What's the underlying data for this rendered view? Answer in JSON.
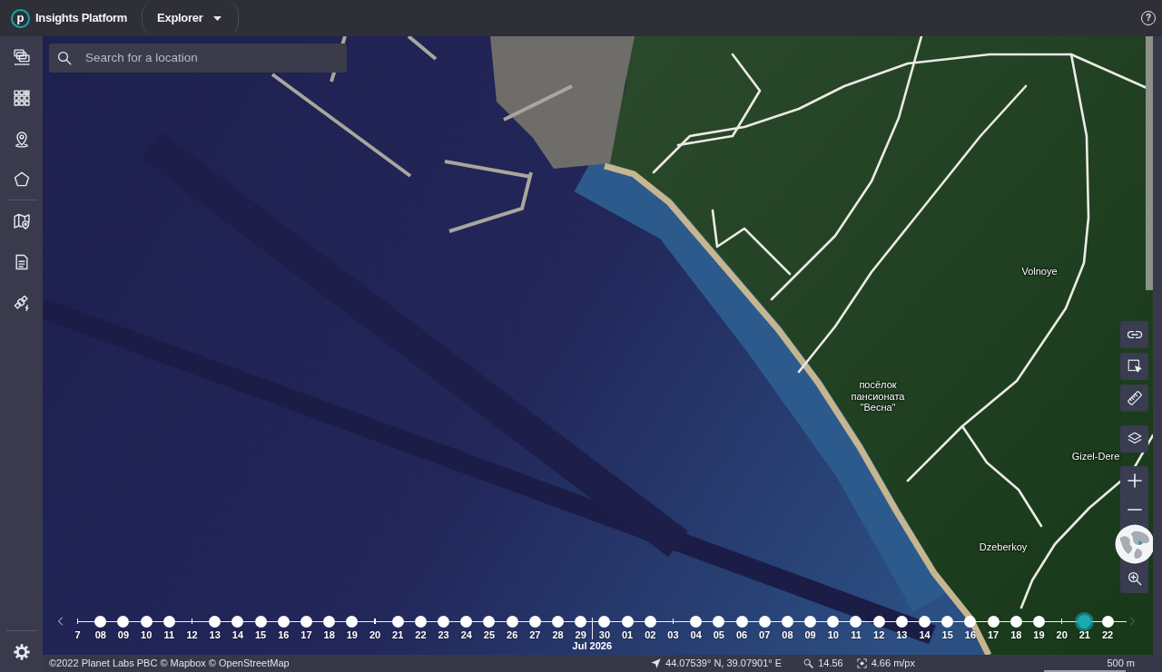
{
  "header": {
    "logo": {
      "letter": "p"
    },
    "title": "Insights Platform",
    "section_menu": {
      "label": "Explorer"
    },
    "help_button": {
      "label": "?"
    }
  },
  "sidebar": {
    "groups": [
      {
        "items": [
          {
            "kind": "screens"
          },
          {
            "kind": "grid"
          },
          {
            "kind": "pin"
          },
          {
            "kind": "polygon"
          }
        ]
      },
      {
        "items": [
          {
            "kind": "map"
          },
          {
            "kind": "report"
          },
          {
            "kind": "satellite"
          }
        ]
      }
    ],
    "footer_items": [
      {
        "kind": "settings"
      }
    ]
  },
  "search": {
    "placeholder": "Search for a location"
  },
  "map": {
    "labels": [
      {
        "text": "Volnoye"
      },
      {
        "text": "посёлок пансионата \"Весна\""
      },
      {
        "text": "Gizel-Dere"
      },
      {
        "text": "Dzeberkoy"
      }
    ]
  },
  "map_tools": {
    "groups": [
      {
        "kind": "buttons",
        "items": [
          {
            "kind": "link"
          },
          {
            "kind": "select"
          },
          {
            "kind": "measure"
          }
        ]
      },
      {
        "kind": "buttons",
        "items": [
          {
            "kind": "layers"
          }
        ]
      },
      {
        "kind": "panel",
        "items": [
          {
            "kind": "zoom-in"
          },
          {
            "kind": "zoom-out"
          },
          {
            "kind": "minimap"
          },
          {
            "kind": "zoom-to"
          }
        ]
      }
    ]
  },
  "timeline": {
    "prev_button": {
      "disabled": false
    },
    "next_button": {
      "disabled": true
    },
    "items": [
      {
        "label": "7",
        "imagery": false,
        "selected": false
      },
      {
        "label": "08",
        "imagery": true,
        "selected": false
      },
      {
        "label": "09",
        "imagery": true,
        "selected": false
      },
      {
        "label": "10",
        "imagery": true,
        "selected": false
      },
      {
        "label": "11",
        "imagery": true,
        "selected": false
      },
      {
        "label": "12",
        "imagery": false,
        "selected": false
      },
      {
        "label": "13",
        "imagery": true,
        "selected": false
      },
      {
        "label": "14",
        "imagery": true,
        "selected": false
      },
      {
        "label": "15",
        "imagery": true,
        "selected": false
      },
      {
        "label": "16",
        "imagery": true,
        "selected": false
      },
      {
        "label": "17",
        "imagery": true,
        "selected": false
      },
      {
        "label": "18",
        "imagery": true,
        "selected": false
      },
      {
        "label": "19",
        "imagery": true,
        "selected": false
      },
      {
        "label": "20",
        "imagery": false,
        "selected": false
      },
      {
        "label": "21",
        "imagery": true,
        "selected": false
      },
      {
        "label": "22",
        "imagery": true,
        "selected": false
      },
      {
        "label": "23",
        "imagery": true,
        "selected": false
      },
      {
        "label": "24",
        "imagery": true,
        "selected": false
      },
      {
        "label": "25",
        "imagery": true,
        "selected": false
      },
      {
        "label": "26",
        "imagery": true,
        "selected": false
      },
      {
        "label": "27",
        "imagery": true,
        "selected": false
      },
      {
        "label": "28",
        "imagery": true,
        "selected": false
      },
      {
        "label": "29",
        "imagery": true,
        "selected": false
      },
      {
        "label": "30",
        "imagery": true,
        "selected": false,
        "month_label": "Jul 2026"
      },
      {
        "label": "01",
        "imagery": true,
        "selected": false
      },
      {
        "label": "02",
        "imagery": true,
        "selected": false
      },
      {
        "label": "03",
        "imagery": false,
        "selected": false
      },
      {
        "label": "04",
        "imagery": true,
        "selected": false
      },
      {
        "label": "05",
        "imagery": true,
        "selected": false
      },
      {
        "label": "06",
        "imagery": true,
        "selected": false
      },
      {
        "label": "07",
        "imagery": true,
        "selected": false
      },
      {
        "label": "08",
        "imagery": true,
        "selected": false
      },
      {
        "label": "09",
        "imagery": true,
        "selected": false
      },
      {
        "label": "10",
        "imagery": true,
        "selected": false
      },
      {
        "label": "11",
        "imagery": true,
        "selected": false
      },
      {
        "label": "12",
        "imagery": true,
        "selected": false
      },
      {
        "label": "13",
        "imagery": true,
        "selected": false
      },
      {
        "label": "14",
        "imagery": true,
        "selected": false
      },
      {
        "label": "15",
        "imagery": true,
        "selected": false
      },
      {
        "label": "16",
        "imagery": true,
        "selected": false
      },
      {
        "label": "17",
        "imagery": true,
        "selected": false
      },
      {
        "label": "18",
        "imagery": true,
        "selected": false
      },
      {
        "label": "19",
        "imagery": true,
        "selected": false
      },
      {
        "label": "20",
        "imagery": false,
        "selected": false
      },
      {
        "label": "21",
        "imagery": true,
        "selected": true
      },
      {
        "label": "22",
        "imagery": true,
        "selected": false
      }
    ]
  },
  "status_bar": {
    "attribution": "©2022 Planet Labs PBC © Mapbox © OpenStreetMap",
    "coordinates": "44.07539° N, 39.07901° E",
    "zoom": "14.56",
    "resolution": "4.66 m/px",
    "scale": "500 m"
  }
}
